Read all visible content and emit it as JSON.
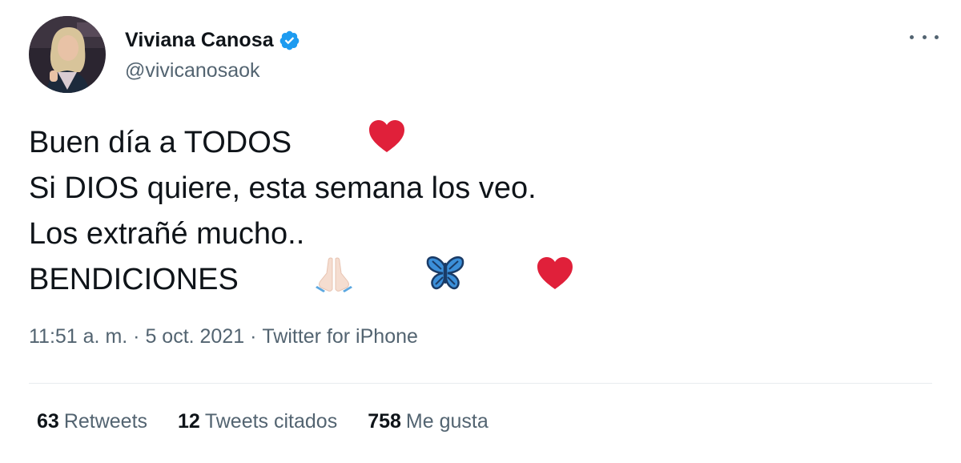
{
  "author": {
    "display_name": "Viviana Canosa",
    "handle": "@vivicanosaok",
    "verified": true,
    "avatar_icon": "profile-photo"
  },
  "more_menu_icon": "more-horizontal-icon",
  "tweet": {
    "lines": [
      {
        "text": "Buen día a TODOS",
        "emojis": [
          "red-heart"
        ]
      },
      {
        "text": "Si DIOS quiere, esta semana los veo.",
        "emojis": []
      },
      {
        "text": "Los extrañé mucho..",
        "emojis": []
      },
      {
        "text": "BENDICIONES",
        "emojis": [
          "folded-hands",
          "butterfly",
          "red-heart"
        ]
      }
    ]
  },
  "meta": {
    "time": "11:51 a. m.",
    "separator": " · ",
    "date": "5 oct. 2021",
    "source": "Twitter for iPhone"
  },
  "stats": {
    "retweets": {
      "count": "63",
      "label": "Retweets"
    },
    "quotes": {
      "count": "12",
      "label": "Tweets citados"
    },
    "likes": {
      "count": "758",
      "label": "Me gusta"
    }
  },
  "colors": {
    "text": "#0f1419",
    "secondary": "#536471",
    "verified_blue": "#1d9bf0",
    "heart_red": "#e0203a",
    "butterfly_blue": "#3b8fd9"
  }
}
